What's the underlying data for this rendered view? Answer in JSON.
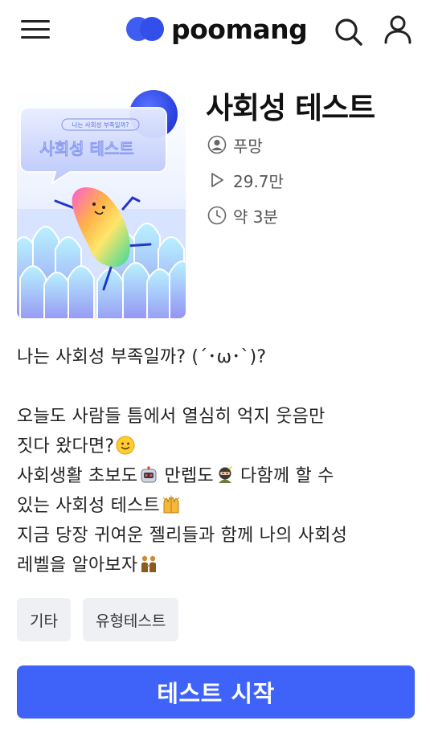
{
  "header": {
    "logo_text": "poomang",
    "menu_icon": "hamburger-menu-icon",
    "search_icon": "search-icon",
    "user_icon": "user-icon",
    "brand_color": "#3e5ef2"
  },
  "test": {
    "thumbnail": {
      "bubble_small": "나는 사회성 부족일까?",
      "bubble_title": "사회성 테스트"
    },
    "title": "사회성 테스트",
    "author": "푸망",
    "plays": "29.7만",
    "duration": "약 3분"
  },
  "description": {
    "line1": "나는 사회성 부족일까? (´･ω･`)?",
    "line2": "오늘도 사람들 틈에서 열심히 억지 웃음만",
    "line3": "짓다 왔다면?",
    "line4a": "사회생활 초보도",
    "line4b": " 만렙도",
    "line4c": " 다함께 할 수",
    "line5": "있는 사회성 테스트",
    "line6": "지금 당장 귀여운 젤리들과 함께 나의 사회성",
    "line7": "레벨을 알아보자",
    "emoji_icons": [
      "smiling-face-icon",
      "robot-icon",
      "ninja-icon",
      "raising-hands-icon",
      "people-holding-hands-icon"
    ]
  },
  "tags": [
    "기타",
    "유형테스트"
  ],
  "cta": {
    "label": "테스트 시작",
    "color": "#3f63f8"
  }
}
